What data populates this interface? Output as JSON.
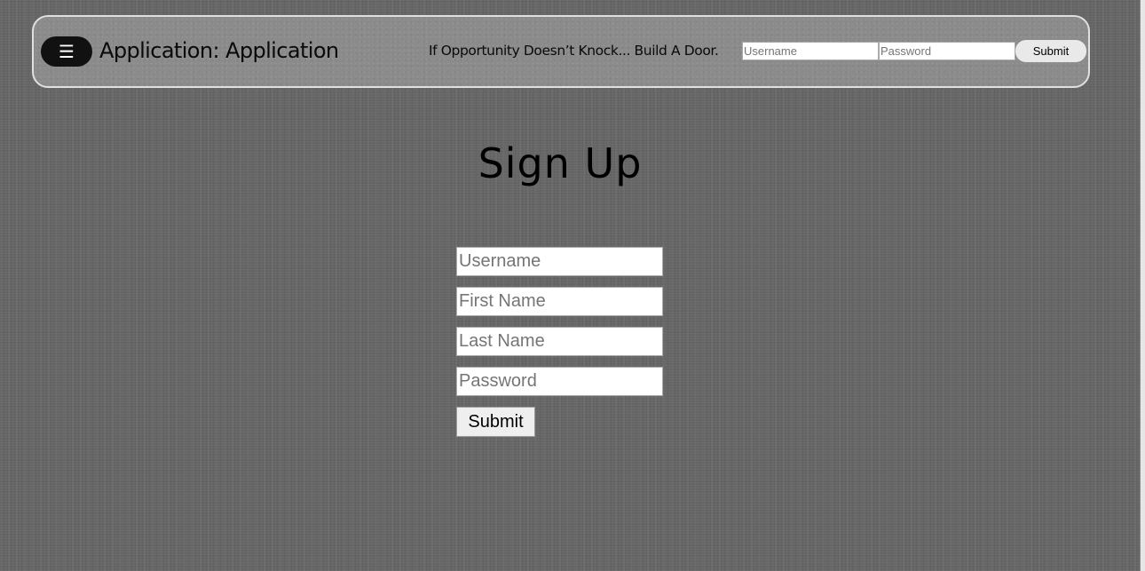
{
  "navbar": {
    "menu_icon": "☰",
    "menu_icon_name": "hamburger-menu-icon",
    "app_title": "Application: Application",
    "tagline": "If Opportunity Doesn’t Knock... Build A Door.",
    "login": {
      "username_placeholder": "Username",
      "password_placeholder": "Password",
      "submit_label": "Submit"
    }
  },
  "signup": {
    "heading": "Sign Up",
    "username_placeholder": "Username",
    "first_name_placeholder": "First Name",
    "last_name_placeholder": "Last Name",
    "password_placeholder": "Password",
    "submit_label": "Submit"
  },
  "colors": {
    "background": "#666666",
    "navbar_background": "#8b8b8b",
    "navbar_border": "#e0e0e0",
    "menu_button": "#111111",
    "text": "#000000"
  }
}
